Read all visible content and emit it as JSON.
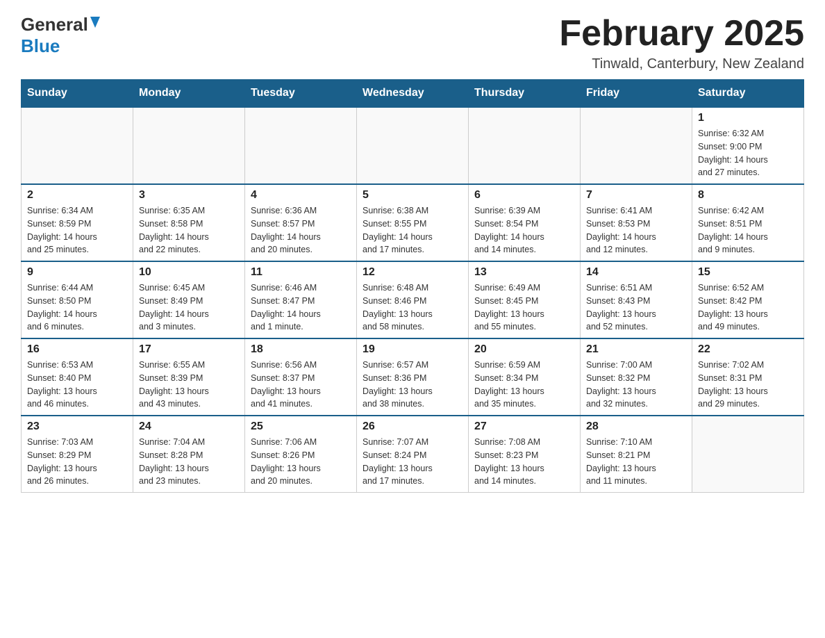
{
  "header": {
    "logo_general": "General",
    "logo_blue": "Blue",
    "month_title": "February 2025",
    "location": "Tinwald, Canterbury, New Zealand"
  },
  "days_of_week": [
    "Sunday",
    "Monday",
    "Tuesday",
    "Wednesday",
    "Thursday",
    "Friday",
    "Saturday"
  ],
  "weeks": [
    [
      {
        "day": "",
        "info": ""
      },
      {
        "day": "",
        "info": ""
      },
      {
        "day": "",
        "info": ""
      },
      {
        "day": "",
        "info": ""
      },
      {
        "day": "",
        "info": ""
      },
      {
        "day": "",
        "info": ""
      },
      {
        "day": "1",
        "info": "Sunrise: 6:32 AM\nSunset: 9:00 PM\nDaylight: 14 hours\nand 27 minutes."
      }
    ],
    [
      {
        "day": "2",
        "info": "Sunrise: 6:34 AM\nSunset: 8:59 PM\nDaylight: 14 hours\nand 25 minutes."
      },
      {
        "day": "3",
        "info": "Sunrise: 6:35 AM\nSunset: 8:58 PM\nDaylight: 14 hours\nand 22 minutes."
      },
      {
        "day": "4",
        "info": "Sunrise: 6:36 AM\nSunset: 8:57 PM\nDaylight: 14 hours\nand 20 minutes."
      },
      {
        "day": "5",
        "info": "Sunrise: 6:38 AM\nSunset: 8:55 PM\nDaylight: 14 hours\nand 17 minutes."
      },
      {
        "day": "6",
        "info": "Sunrise: 6:39 AM\nSunset: 8:54 PM\nDaylight: 14 hours\nand 14 minutes."
      },
      {
        "day": "7",
        "info": "Sunrise: 6:41 AM\nSunset: 8:53 PM\nDaylight: 14 hours\nand 12 minutes."
      },
      {
        "day": "8",
        "info": "Sunrise: 6:42 AM\nSunset: 8:51 PM\nDaylight: 14 hours\nand 9 minutes."
      }
    ],
    [
      {
        "day": "9",
        "info": "Sunrise: 6:44 AM\nSunset: 8:50 PM\nDaylight: 14 hours\nand 6 minutes."
      },
      {
        "day": "10",
        "info": "Sunrise: 6:45 AM\nSunset: 8:49 PM\nDaylight: 14 hours\nand 3 minutes."
      },
      {
        "day": "11",
        "info": "Sunrise: 6:46 AM\nSunset: 8:47 PM\nDaylight: 14 hours\nand 1 minute."
      },
      {
        "day": "12",
        "info": "Sunrise: 6:48 AM\nSunset: 8:46 PM\nDaylight: 13 hours\nand 58 minutes."
      },
      {
        "day": "13",
        "info": "Sunrise: 6:49 AM\nSunset: 8:45 PM\nDaylight: 13 hours\nand 55 minutes."
      },
      {
        "day": "14",
        "info": "Sunrise: 6:51 AM\nSunset: 8:43 PM\nDaylight: 13 hours\nand 52 minutes."
      },
      {
        "day": "15",
        "info": "Sunrise: 6:52 AM\nSunset: 8:42 PM\nDaylight: 13 hours\nand 49 minutes."
      }
    ],
    [
      {
        "day": "16",
        "info": "Sunrise: 6:53 AM\nSunset: 8:40 PM\nDaylight: 13 hours\nand 46 minutes."
      },
      {
        "day": "17",
        "info": "Sunrise: 6:55 AM\nSunset: 8:39 PM\nDaylight: 13 hours\nand 43 minutes."
      },
      {
        "day": "18",
        "info": "Sunrise: 6:56 AM\nSunset: 8:37 PM\nDaylight: 13 hours\nand 41 minutes."
      },
      {
        "day": "19",
        "info": "Sunrise: 6:57 AM\nSunset: 8:36 PM\nDaylight: 13 hours\nand 38 minutes."
      },
      {
        "day": "20",
        "info": "Sunrise: 6:59 AM\nSunset: 8:34 PM\nDaylight: 13 hours\nand 35 minutes."
      },
      {
        "day": "21",
        "info": "Sunrise: 7:00 AM\nSunset: 8:32 PM\nDaylight: 13 hours\nand 32 minutes."
      },
      {
        "day": "22",
        "info": "Sunrise: 7:02 AM\nSunset: 8:31 PM\nDaylight: 13 hours\nand 29 minutes."
      }
    ],
    [
      {
        "day": "23",
        "info": "Sunrise: 7:03 AM\nSunset: 8:29 PM\nDaylight: 13 hours\nand 26 minutes."
      },
      {
        "day": "24",
        "info": "Sunrise: 7:04 AM\nSunset: 8:28 PM\nDaylight: 13 hours\nand 23 minutes."
      },
      {
        "day": "25",
        "info": "Sunrise: 7:06 AM\nSunset: 8:26 PM\nDaylight: 13 hours\nand 20 minutes."
      },
      {
        "day": "26",
        "info": "Sunrise: 7:07 AM\nSunset: 8:24 PM\nDaylight: 13 hours\nand 17 minutes."
      },
      {
        "day": "27",
        "info": "Sunrise: 7:08 AM\nSunset: 8:23 PM\nDaylight: 13 hours\nand 14 minutes."
      },
      {
        "day": "28",
        "info": "Sunrise: 7:10 AM\nSunset: 8:21 PM\nDaylight: 13 hours\nand 11 minutes."
      },
      {
        "day": "",
        "info": ""
      }
    ]
  ]
}
